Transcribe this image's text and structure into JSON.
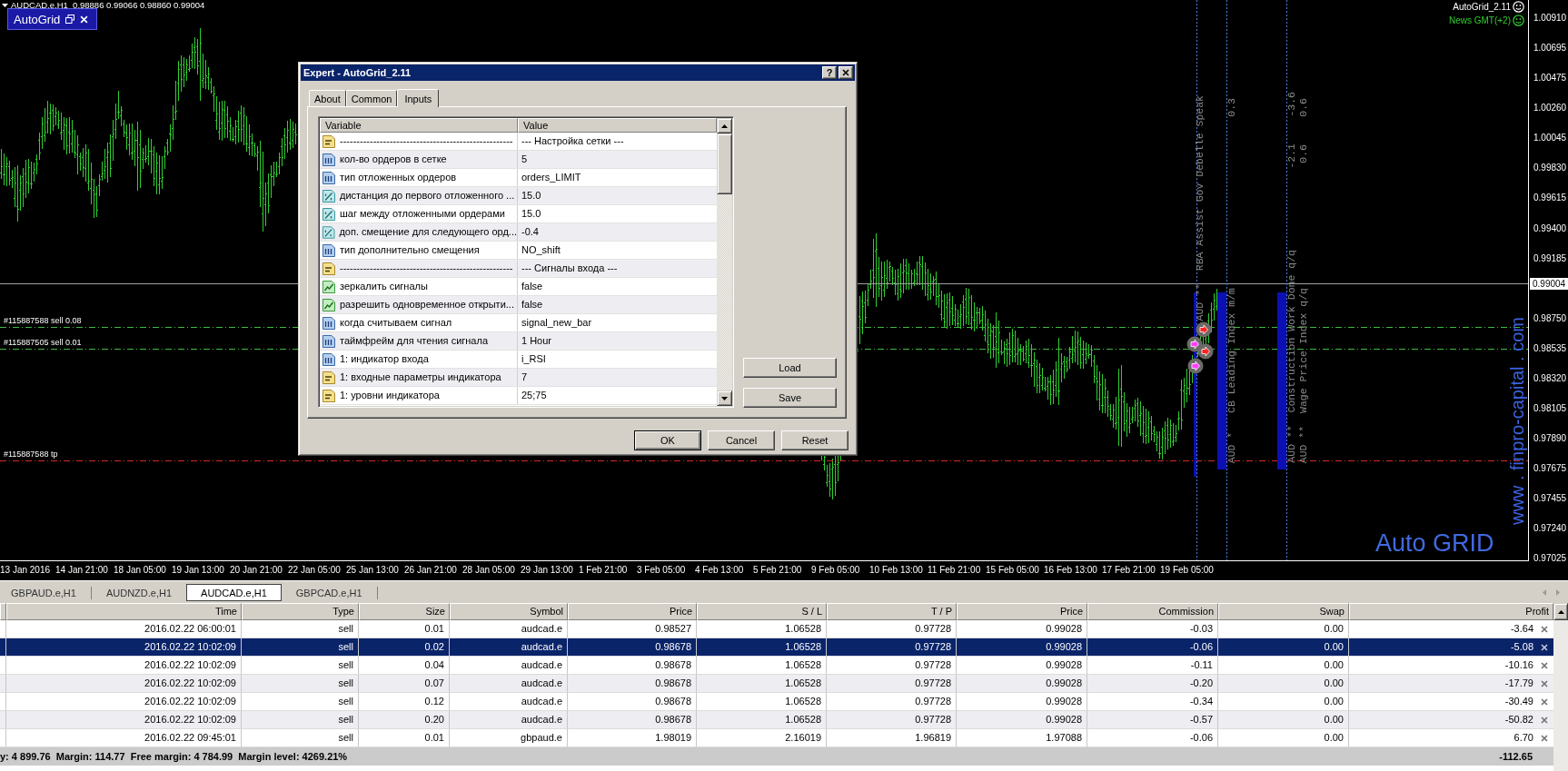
{
  "chart": {
    "title": "AUDCAD.e,H1  0.98886 0.99066 0.98860 0.99004",
    "expert_label": "AutoGrid",
    "info_lines": [
      {
        "text": "AutoGrid_2.11",
        "color": "#ffffff"
      },
      {
        "text": "News GMT(+2)",
        "color": "#33cc33"
      }
    ],
    "order_lines": [
      {
        "label": "#115887588 sell 0.08",
        "kind": "sell"
      },
      {
        "label": "#115887505 sell 0.01",
        "kind": "sell"
      },
      {
        "label": "#115887588 tp",
        "kind": "tp"
      }
    ],
    "news_labels": [
      "AUD **  RBA Assist Gov Debelle Speak",
      "0.3",
      "AUD *   CB Leading Index m/m",
      "-3.6",
      "-2.1",
      "AUD **  Construction Work Done q/q",
      "0.6",
      "0.6",
      "AUD **  Wage Price Index q/q"
    ],
    "logo_text": "Auto GRID",
    "site_label": "www . finpro-capital . com",
    "current_price": "0.99004",
    "price_axis": [
      "1.00910",
      "1.00695",
      "1.00475",
      "1.00260",
      "1.00045",
      "0.99830",
      "0.99615",
      "0.99400",
      "0.99185",
      "0.98750",
      "0.98535",
      "0.98320",
      "0.98105",
      "0.97890",
      "0.97675",
      "0.97455",
      "0.97240",
      "0.97025"
    ],
    "date_axis": [
      "13 Jan 2016",
      "14 Jan 21:00",
      "18 Jan 05:00",
      "19 Jan 13:00",
      "20 Jan 21:00",
      "22 Jan 05:00",
      "25 Jan 13:00",
      "26 Jan 21:00",
      "28 Jan 05:00",
      "29 Jan 13:00",
      "1 Feb 21:00",
      "3 Feb 05:00",
      "4 Feb 13:00",
      "5 Feb 21:00",
      "9 Feb 05:00",
      "10 Feb 13:00",
      "11 Feb 21:00",
      "15 Feb 05:00",
      "16 Feb 13:00",
      "17 Feb 21:00",
      "19 Feb 05:00"
    ]
  },
  "dialog": {
    "title": "Expert - AutoGrid_2.11",
    "help_button": "?",
    "tabs": [
      {
        "label": "About",
        "selected": false
      },
      {
        "label": "Common",
        "selected": false
      },
      {
        "label": "Inputs",
        "selected": true
      }
    ],
    "columns": [
      "Variable",
      "Value"
    ],
    "rows": [
      {
        "kind": "string",
        "variable": "----------------------------------------------------",
        "value": "--- Настройка сетки ---"
      },
      {
        "kind": "int",
        "variable": "кол-во ордеров в сетке",
        "value": "5"
      },
      {
        "kind": "int",
        "variable": "тип отложенных ордеров",
        "value": "orders_LIMIT"
      },
      {
        "kind": "double",
        "variable": "дистанция до первого отложенного ...",
        "value": "15.0"
      },
      {
        "kind": "double",
        "variable": "шаг между отложенными ордерами",
        "value": "15.0"
      },
      {
        "kind": "double",
        "variable": "доп. смещение для следующего орд...",
        "value": "-0.4"
      },
      {
        "kind": "int",
        "variable": "тип дополнительно смещения",
        "value": "NO_shift"
      },
      {
        "kind": "string",
        "variable": "----------------------------------------------------",
        "value": "--- Сигналы входа ---"
      },
      {
        "kind": "bool",
        "variable": "зеркалить сигналы",
        "value": "false"
      },
      {
        "kind": "bool",
        "variable": "разрешить одновременное открыти...",
        "value": "false"
      },
      {
        "kind": "int",
        "variable": "когда считываем сигнал",
        "value": "signal_new_bar"
      },
      {
        "kind": "int",
        "variable": "таймфрейм для чтения сигнала",
        "value": "1 Hour"
      },
      {
        "kind": "int",
        "variable": "1: индикатор входа",
        "value": "i_RSI"
      },
      {
        "kind": "string",
        "variable": "1: входные параметры индикатора",
        "value": "7"
      },
      {
        "kind": "string",
        "variable": "1: уровни индикатора",
        "value": "25;75"
      }
    ],
    "side_buttons": [
      "Load",
      "Save"
    ],
    "buttons": [
      {
        "label": "OK",
        "default": true
      },
      {
        "label": "Cancel",
        "default": false
      },
      {
        "label": "Reset",
        "default": false
      }
    ]
  },
  "terminal": {
    "chart_tabs": [
      {
        "label": "GBPAUD.e,H1",
        "selected": false
      },
      {
        "label": "AUDNZD.e,H1",
        "selected": false
      },
      {
        "label": "AUDCAD.e,H1",
        "selected": true
      },
      {
        "label": "GBPCAD.e,H1",
        "selected": false
      }
    ],
    "columns": [
      "Time",
      "Type",
      "Size",
      "Symbol",
      "Price",
      "S / L",
      "T / P",
      "Price",
      "Commission",
      "Swap",
      "Profit"
    ],
    "rows": [
      {
        "cells": [
          "2016.02.22 06:00:01",
          "sell",
          "0.01",
          "audcad.e",
          "0.98527",
          "1.06528",
          "0.97728",
          "0.99028",
          "-0.03",
          "0.00",
          "-3.64"
        ],
        "selected": false
      },
      {
        "cells": [
          "2016.02.22 10:02:09",
          "sell",
          "0.02",
          "audcad.e",
          "0.98678",
          "1.06528",
          "0.97728",
          "0.99028",
          "-0.06",
          "0.00",
          "-5.08"
        ],
        "selected": true
      },
      {
        "cells": [
          "2016.02.22 10:02:09",
          "sell",
          "0.04",
          "audcad.e",
          "0.98678",
          "1.06528",
          "0.97728",
          "0.99028",
          "-0.11",
          "0.00",
          "-10.16"
        ],
        "selected": false
      },
      {
        "cells": [
          "2016.02.22 10:02:09",
          "sell",
          "0.07",
          "audcad.e",
          "0.98678",
          "1.06528",
          "0.97728",
          "0.99028",
          "-0.20",
          "0.00",
          "-17.79"
        ],
        "selected": false
      },
      {
        "cells": [
          "2016.02.22 10:02:09",
          "sell",
          "0.12",
          "audcad.e",
          "0.98678",
          "1.06528",
          "0.97728",
          "0.99028",
          "-0.34",
          "0.00",
          "-30.49"
        ],
        "selected": false
      },
      {
        "cells": [
          "2016.02.22 10:02:09",
          "sell",
          "0.20",
          "audcad.e",
          "0.98678",
          "1.06528",
          "0.97728",
          "0.99028",
          "-0.57",
          "0.00",
          "-50.82"
        ],
        "selected": false
      },
      {
        "cells": [
          "2016.02.22 09:45:01",
          "sell",
          "0.01",
          "gbpaud.e",
          "1.98019",
          "2.16019",
          "1.96819",
          "1.97088",
          "-0.06",
          "0.00",
          "6.70"
        ],
        "selected": false
      }
    ],
    "summary": {
      "account": "y: 4 899.76  Margin: 114.77  Free margin: 4 784.99  Margin level: 4269.21%",
      "profit": "-112.65"
    }
  }
}
